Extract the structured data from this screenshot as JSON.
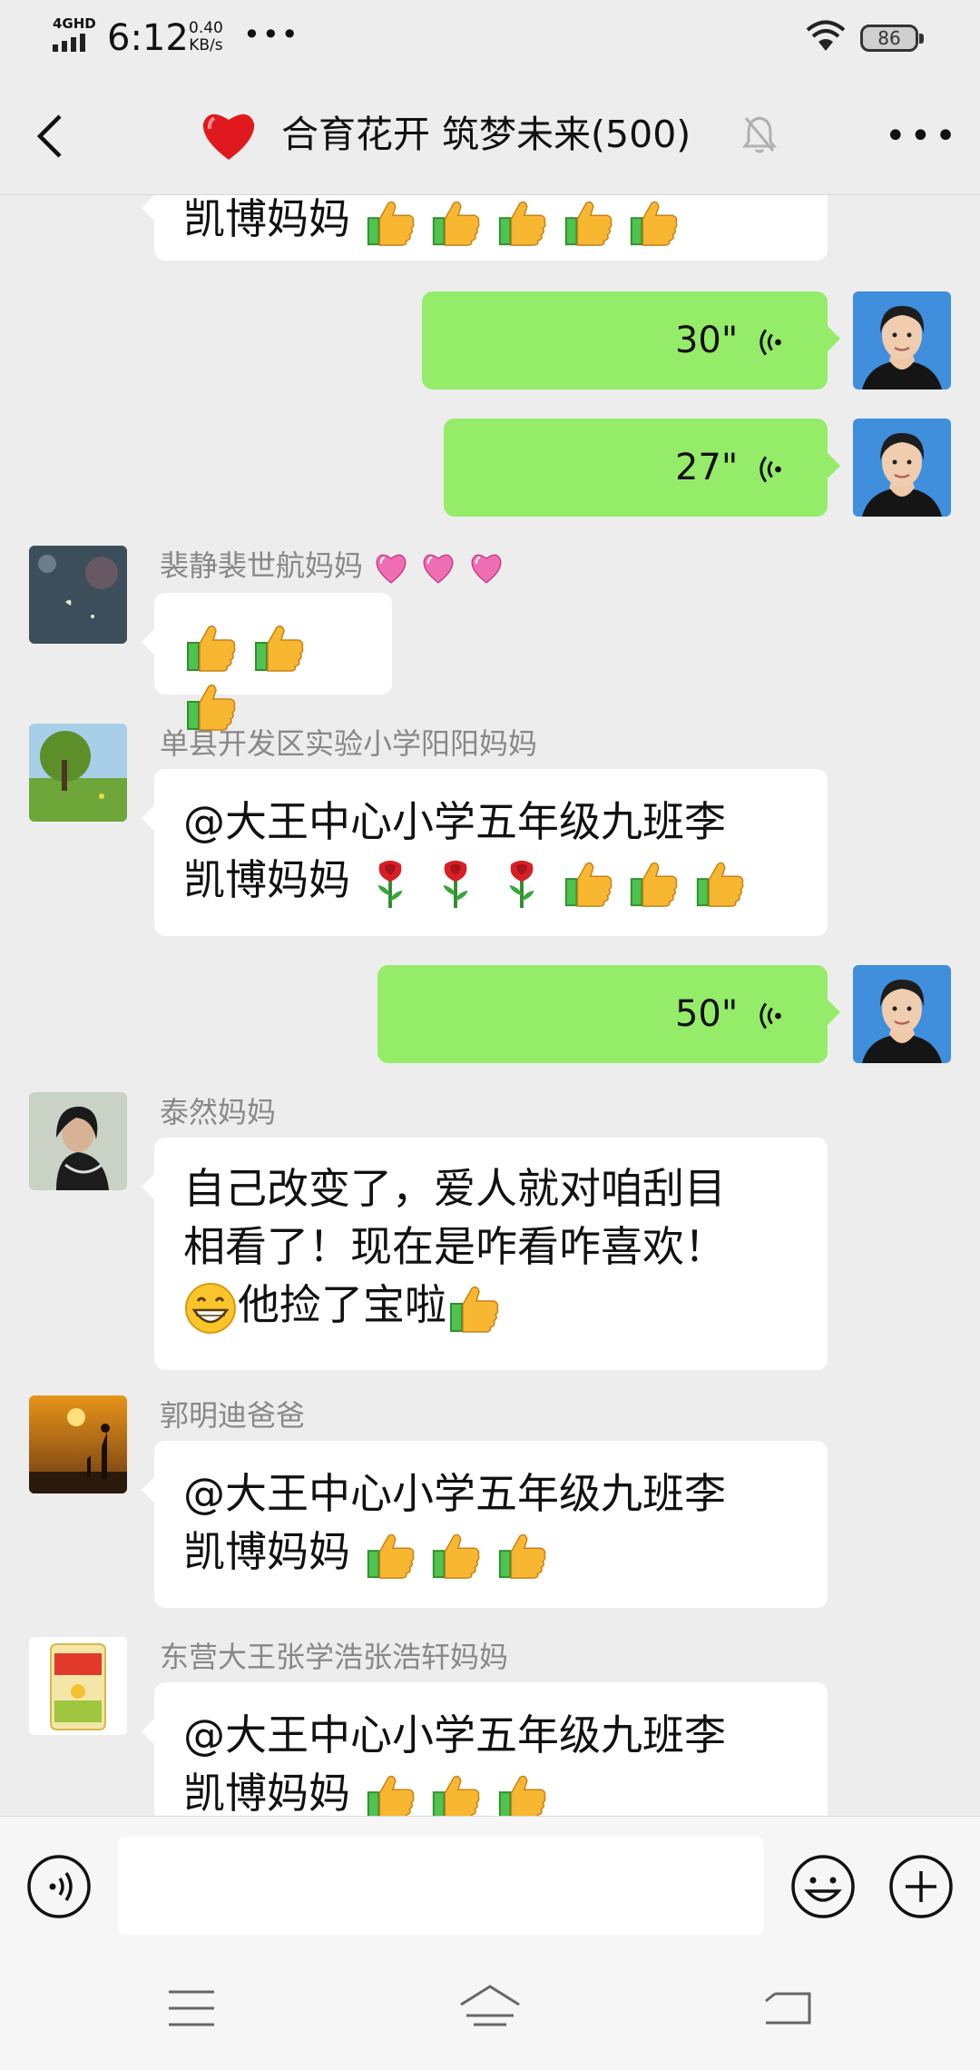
{
  "status_bar": {
    "network": "4GHD",
    "time": "6:12",
    "speed_value": "0.40",
    "speed_unit": "KB/s",
    "more": "•••",
    "battery": "86"
  },
  "header": {
    "title": "合育花开 筑梦未来(500)",
    "icons": [
      "back-icon",
      "heart-icon",
      "mute-bell-icon",
      "more-icon"
    ]
  },
  "messages": [
    {
      "side": "left",
      "text": "凯博妈妈 ",
      "partial": true,
      "emoji": [
        "thumbs-up",
        "thumbs-up",
        "thumbs-up",
        "thumbs-up",
        "thumbs-up"
      ]
    },
    {
      "side": "right",
      "type": "voice",
      "duration": "30\""
    },
    {
      "side": "right",
      "type": "voice",
      "duration": "27\""
    },
    {
      "side": "left",
      "sender": "裴静裴世航妈妈",
      "sender_emoji": [
        "heart-ribbon",
        "sparkling-heart",
        "two-hearts"
      ],
      "text": "",
      "emoji": [
        "thumbs-up",
        "thumbs-up",
        "thumbs-up"
      ]
    },
    {
      "side": "left",
      "sender": "单县开发区实验小学阳阳妈妈",
      "text_line1": "@大王中心小学五年级九班李",
      "text_line2": "凯博妈妈 ",
      "emoji": [
        "rose",
        "rose",
        "rose",
        "thumbs-up",
        "thumbs-up",
        "thumbs-up"
      ]
    },
    {
      "side": "right",
      "type": "voice",
      "duration": "50\""
    },
    {
      "side": "left",
      "sender": "泰然妈妈",
      "text_line1": "自己改变了，爱人就对咱刮目",
      "text_line2": "相看了！现在是咋看咋喜欢！",
      "text_line3": "他捡了宝啦",
      "emoji": [
        "grin",
        "thumbs-up"
      ]
    },
    {
      "side": "left",
      "sender": "郭明迪爸爸",
      "text_line1": "@大王中心小学五年级九班李",
      "text_line2": "凯博妈妈 ",
      "emoji": [
        "thumbs-up",
        "thumbs-up",
        "thumbs-up"
      ]
    },
    {
      "side": "left",
      "sender": "东营大王张学浩张浩轩妈妈",
      "text_line1": "@大王中心小学五年级九班李",
      "text_line2": "凯博妈妈 ",
      "emoji": [
        "thumbs-up",
        "thumbs-up",
        "thumbs-up"
      ]
    }
  ],
  "input_bar": {
    "value": "",
    "icons": [
      "voice-input-icon",
      "emoji-icon",
      "plus-icon"
    ]
  },
  "nav_keys": [
    "menu-icon",
    "home-icon",
    "back-nav-icon"
  ],
  "colors": {
    "background": "#ededed",
    "self_bubble": "#95ec69",
    "other_bubble": "#ffffff",
    "sender_name": "#888888"
  }
}
